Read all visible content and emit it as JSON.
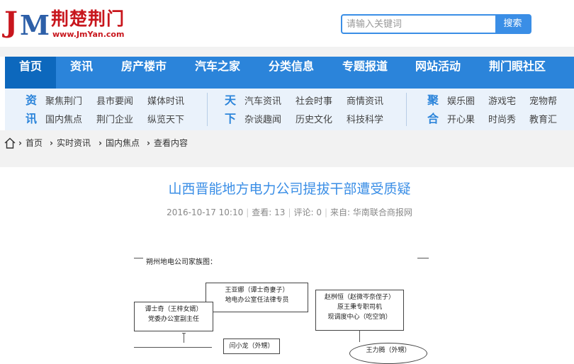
{
  "site": {
    "logo_letters": "JM",
    "name": "荆楚荆门",
    "url": "www.JmYan.com"
  },
  "search": {
    "placeholder": "请输入关键词",
    "button": "搜索"
  },
  "nav": {
    "items": [
      "首页",
      "资讯",
      "房产楼市",
      "汽车之家",
      "分类信息",
      "专题报道",
      "网站活动",
      "荆门眼社区"
    ]
  },
  "subnav": {
    "group1": {
      "label_top": "资",
      "label_bottom": "讯",
      "links": [
        "聚焦荆门",
        "县市要闻",
        "媒体时讯",
        "国内焦点",
        "荆门企业",
        "纵览天下"
      ]
    },
    "group2": {
      "label_top": "天",
      "label_bottom": "下",
      "links": [
        "汽车资讯",
        "社会时事",
        "商情资讯",
        "杂谈趣闻",
        "历史文化",
        "科技科学"
      ]
    },
    "group3": {
      "label_top": "聚",
      "label_bottom": "合",
      "links": [
        "娱乐圈",
        "游戏宅",
        "宠物帮",
        "开心果",
        "时尚秀",
        "教育汇"
      ]
    }
  },
  "breadcrumb": [
    "首页",
    "实时资讯",
    "国内焦点",
    "查看内容"
  ],
  "article": {
    "title": "山西晋能地方电力公司提拔干部遭受质疑",
    "date": "2016-10-17 10:10",
    "views": "查看: 13",
    "comments": "评论: 0",
    "source": "来自: 华南联合商报网"
  },
  "diagram": {
    "heading": "朔州地电公司家族图：",
    "box1": [
      "王亚娜（谭士奇妻子）",
      "地电办公室任法律专员"
    ],
    "box2": [
      "赵桝恒（赵微岑奈侄子）",
      "原王秉专职司机",
      "现调度中心（吃空饷）"
    ],
    "box3": [
      "谭士奇（王梓女婿）",
      "党委办公室副主任"
    ],
    "box4": [
      "闫小龙（外甥）"
    ],
    "box5": [
      "王力腾（外甥）"
    ]
  }
}
